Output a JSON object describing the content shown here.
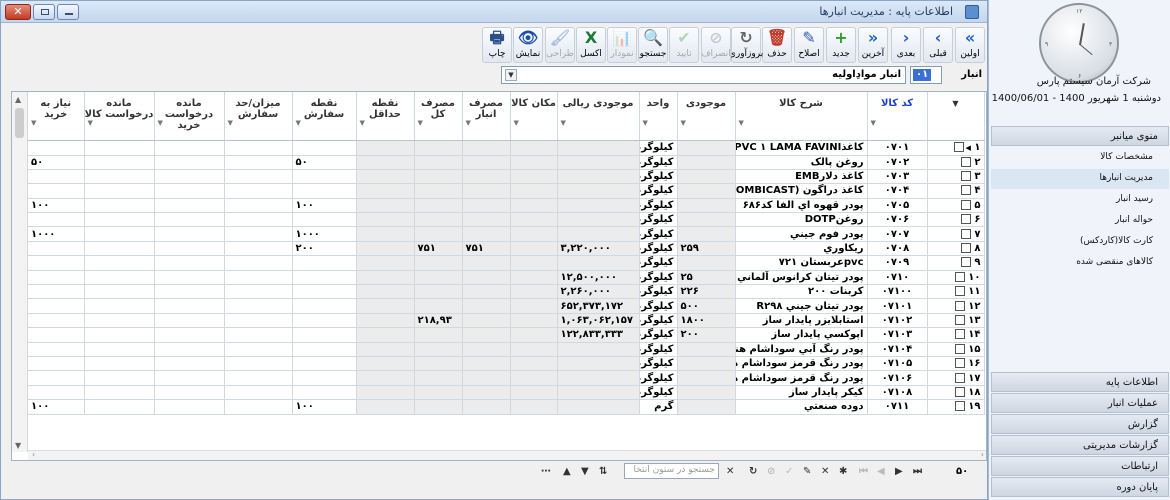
{
  "window": {
    "title": "اطلاعات پایه : مدیریت انبارها"
  },
  "toolbar": [
    {
      "label": "اولین",
      "icon": "first-icon",
      "glyph": "«",
      "enabled": true
    },
    {
      "label": "قبلی",
      "icon": "prev-icon",
      "glyph": "‹",
      "enabled": true
    },
    {
      "label": "بعدی",
      "icon": "next-icon",
      "glyph": "›",
      "enabled": true
    },
    {
      "label": "آخرین",
      "icon": "last-icon",
      "glyph": "»",
      "enabled": true
    },
    {
      "label": "جدید",
      "icon": "plus-icon",
      "glyph": "+",
      "enabled": true
    },
    {
      "label": "اصلاح",
      "icon": "pencil-icon",
      "glyph": "✎",
      "enabled": true
    },
    {
      "label": "حذف",
      "icon": "trash-icon",
      "glyph": "🗑",
      "enabled": true
    },
    {
      "label": "بروزآوری",
      "icon": "refresh-icon",
      "glyph": "↻",
      "enabled": true
    },
    {
      "label": "انصراف",
      "icon": "cancel-icon",
      "glyph": "⊘",
      "enabled": false
    },
    {
      "label": "تایید",
      "icon": "check-icon",
      "glyph": "✔",
      "enabled": false
    },
    {
      "label": "جستجو",
      "icon": "search-icon",
      "glyph": "🔍",
      "enabled": true
    },
    {
      "label": "نمودار",
      "icon": "chart-icon",
      "glyph": "📊",
      "enabled": false
    },
    {
      "label": "اکسل",
      "icon": "excel-icon",
      "glyph": "X",
      "enabled": true
    },
    {
      "label": "طراحی",
      "icon": "brush-icon",
      "glyph": "🖌",
      "enabled": false
    },
    {
      "label": "نمایش",
      "icon": "eye-icon",
      "glyph": "👁",
      "enabled": true
    },
    {
      "label": "چاپ",
      "icon": "printer-icon",
      "glyph": "🖶",
      "enabled": true
    }
  ],
  "warehouse": {
    "label": "انبار",
    "code": "۰۱",
    "name": "انبار موادِاولیه"
  },
  "table": {
    "columns": [
      "کد کالا",
      "شرح کالا",
      "موجودی",
      "واحد",
      "موجودی ریالی",
      "مکان کالا",
      "مصرف انبار",
      "مصرف کل",
      "نقطه حداقل",
      "نقطه سفارش",
      "میزان/حد سفارش",
      "مانده درخواست خرید",
      "مانده درخواست کالا",
      "نیاز به خرید"
    ],
    "rows": [
      {
        "n": "۱",
        "code": "۰۷۰۱",
        "desc": "کاغذPVC ۱ LAMA FAVINI",
        "qty": "",
        "unit": "کیلوگرم",
        "rial": "",
        "loc": "",
        "use_wh": "",
        "use_all": "",
        "min": "",
        "order_pt": "",
        "order_lim": "",
        "rem_buy": "",
        "rem_item": "",
        "need": ""
      },
      {
        "n": "۲",
        "code": "۰۷۰۲",
        "desc": "روغن پالک",
        "qty": "",
        "unit": "کیلوگرم",
        "rial": "",
        "loc": "",
        "use_wh": "",
        "use_all": "",
        "min": "",
        "order_pt": "۵۰",
        "order_lim": "",
        "rem_buy": "",
        "rem_item": "",
        "need": "۵۰"
      },
      {
        "n": "۳",
        "code": "۰۷۰۳",
        "desc": "کاغذ دلارEMB",
        "qty": "",
        "unit": "کیلوگرم",
        "rial": "",
        "loc": "",
        "use_wh": "",
        "use_all": "",
        "min": "",
        "order_pt": "",
        "order_lim": "",
        "rem_buy": "",
        "rem_item": "",
        "need": ""
      },
      {
        "n": "۴",
        "code": "۰۷۰۴",
        "desc": "کاغذ دراگون (COMBICAST)",
        "qty": "",
        "unit": "کیلوگرم",
        "rial": "",
        "loc": "",
        "use_wh": "",
        "use_all": "",
        "min": "",
        "order_pt": "",
        "order_lim": "",
        "rem_buy": "",
        "rem_item": "",
        "need": ""
      },
      {
        "n": "۵",
        "code": "۰۷۰۵",
        "desc": "پودر قهوه اي الفا كد۶۸۶",
        "qty": "",
        "unit": "کیلوگرم",
        "rial": "",
        "loc": "",
        "use_wh": "",
        "use_all": "",
        "min": "",
        "order_pt": "۱۰۰",
        "order_lim": "",
        "rem_buy": "",
        "rem_item": "",
        "need": "۱۰۰"
      },
      {
        "n": "۶",
        "code": "۰۷۰۶",
        "desc": "روغنDOTP",
        "qty": "",
        "unit": "کیلوگرم",
        "rial": "",
        "loc": "",
        "use_wh": "",
        "use_all": "",
        "min": "",
        "order_pt": "",
        "order_lim": "",
        "rem_buy": "",
        "rem_item": "",
        "need": ""
      },
      {
        "n": "۷",
        "code": "۰۷۰۷",
        "desc": "پودر فوم جيني",
        "qty": "",
        "unit": "کیلوگرم",
        "rial": "",
        "loc": "",
        "use_wh": "",
        "use_all": "",
        "min": "",
        "order_pt": "۱۰۰۰",
        "order_lim": "",
        "rem_buy": "",
        "rem_item": "",
        "need": "۱۰۰۰"
      },
      {
        "n": "۸",
        "code": "۰۷۰۸",
        "desc": "ريكاوري",
        "qty": "۲۵۹",
        "unit": "کیلوگرم",
        "rial": "۳,۲۲۰,۰۰۰",
        "loc": "",
        "use_wh": "۷۵۱",
        "use_all": "۷۵۱",
        "min": "",
        "order_pt": "۲۰۰",
        "order_lim": "",
        "rem_buy": "",
        "rem_item": "",
        "need": ""
      },
      {
        "n": "۹",
        "code": "۰۷۰۹",
        "desc": "pvcعربستان ۷۲۱",
        "qty": "",
        "unit": "کیلوگرم",
        "rial": "",
        "loc": "",
        "use_wh": "",
        "use_all": "",
        "min": "",
        "order_pt": "",
        "order_lim": "",
        "rem_buy": "",
        "rem_item": "",
        "need": ""
      },
      {
        "n": "۱۰",
        "code": "۰۷۱۰",
        "desc": "پودر تيتان كرانوس آلماني",
        "qty": "۲۵",
        "unit": "کیلوگرم",
        "rial": "۱۲,۵۰۰,۰۰۰",
        "loc": "",
        "use_wh": "",
        "use_all": "",
        "min": "",
        "order_pt": "",
        "order_lim": "",
        "rem_buy": "",
        "rem_item": "",
        "need": ""
      },
      {
        "n": "۱۱",
        "code": "۰۷۱۰۰",
        "desc": "كربنات ۲۰۰",
        "qty": "۲۲۶",
        "unit": "کیلوگرم",
        "rial": "۲,۲۶۰,۰۰۰",
        "loc": "",
        "use_wh": "",
        "use_all": "",
        "min": "",
        "order_pt": "",
        "order_lim": "",
        "rem_buy": "",
        "rem_item": "",
        "need": ""
      },
      {
        "n": "۱۲",
        "code": "۰۷۱۰۱",
        "desc": "پودر تيتان جيني   R۲۹۸",
        "qty": "۵۰۰",
        "unit": "کیلوگرم",
        "rial": "۶۵۲,۳۷۳,۱۷۲",
        "loc": "",
        "use_wh": "",
        "use_all": "",
        "min": "",
        "order_pt": "",
        "order_lim": "",
        "rem_buy": "",
        "rem_item": "",
        "need": ""
      },
      {
        "n": "۱۳",
        "code": "۰۷۱۰۲",
        "desc": "استابلايزر پايدار ساز",
        "qty": "۱۸۰۰",
        "unit": "کیلوگرم",
        "rial": "۱,۰۶۳,۰۶۲,۱۵۷",
        "loc": "",
        "use_wh": "",
        "use_all": "۲۱۸,۹۳",
        "min": "",
        "order_pt": "",
        "order_lim": "",
        "rem_buy": "",
        "rem_item": "",
        "need": ""
      },
      {
        "n": "۱۴",
        "code": "۰۷۱۰۳",
        "desc": "اپوكسي پايدار ساز",
        "qty": "۲۰۰",
        "unit": "کیلوگرم",
        "rial": "۱۲۲,۸۳۳,۳۳۳",
        "loc": "",
        "use_wh": "",
        "use_all": "",
        "min": "",
        "order_pt": "",
        "order_lim": "",
        "rem_buy": "",
        "rem_item": "",
        "need": ""
      },
      {
        "n": "۱۵",
        "code": "۰۷۱۰۴",
        "desc": "پودر رنگ آبي سوداشام هند",
        "qty": "",
        "unit": "کیلوگرم",
        "rial": "",
        "loc": "",
        "use_wh": "",
        "use_all": "",
        "min": "",
        "order_pt": "",
        "order_lim": "",
        "rem_buy": "",
        "rem_item": "",
        "need": ""
      },
      {
        "n": "۱۶",
        "code": "۰۷۱۰۵",
        "desc": "پودر رنگ قرمز سوداشام هند",
        "qty": "",
        "unit": "کیلوگرم",
        "rial": "",
        "loc": "",
        "use_wh": "",
        "use_all": "",
        "min": "",
        "order_pt": "",
        "order_lim": "",
        "rem_buy": "",
        "rem_item": "",
        "need": ""
      },
      {
        "n": "۱۷",
        "code": "۰۷۱۰۶",
        "desc": "پودر رنگ قرمز سوداشام هند",
        "qty": "",
        "unit": "کیلوگرم",
        "rial": "",
        "loc": "",
        "use_wh": "",
        "use_all": "",
        "min": "",
        "order_pt": "",
        "order_lim": "",
        "rem_buy": "",
        "rem_item": "",
        "need": ""
      },
      {
        "n": "۱۸",
        "code": "۰۷۱۰۸",
        "desc": "كيكر پايدار ساز",
        "qty": "",
        "unit": "کیلوگرم",
        "rial": "",
        "loc": "",
        "use_wh": "",
        "use_all": "",
        "min": "",
        "order_pt": "",
        "order_lim": "",
        "rem_buy": "",
        "rem_item": "",
        "need": ""
      },
      {
        "n": "۱۹",
        "code": "۰۷۱۱",
        "desc": "دوده صنعتي",
        "qty": "",
        "unit": "گرم",
        "rial": "",
        "loc": "",
        "use_wh": "",
        "use_all": "",
        "min": "",
        "order_pt": "۱۰۰",
        "order_lim": "",
        "rem_buy": "",
        "rem_item": "",
        "need": "۱۰۰"
      }
    ]
  },
  "navigator": {
    "search_placeholder": "جستجو در ستون انتخا",
    "record_count": "۵۰"
  },
  "side": {
    "company": "شرکت آرمان سیستم پارس",
    "date": "دوشنبه 1 شهریور 1400 - 1400/06/01",
    "clock_numerals": [
      "۱۲",
      "۳",
      "۶",
      "۹"
    ],
    "menu_title": "منوی میانبر",
    "menu_items": [
      "مشخصات کالا",
      "مدیریت انبارها",
      "رسید انبار",
      "حواله انبار",
      "کارت کالا(کاردکس)",
      "کالاهای منقضی شده"
    ],
    "selected_item": "مدیریت انبارها",
    "bottom_menus": [
      "اطلاعات پایه",
      "عملیات انبار",
      "گزارش",
      "گزارشات مدیریتی",
      "ارتباطات",
      "پایان دوره"
    ]
  }
}
